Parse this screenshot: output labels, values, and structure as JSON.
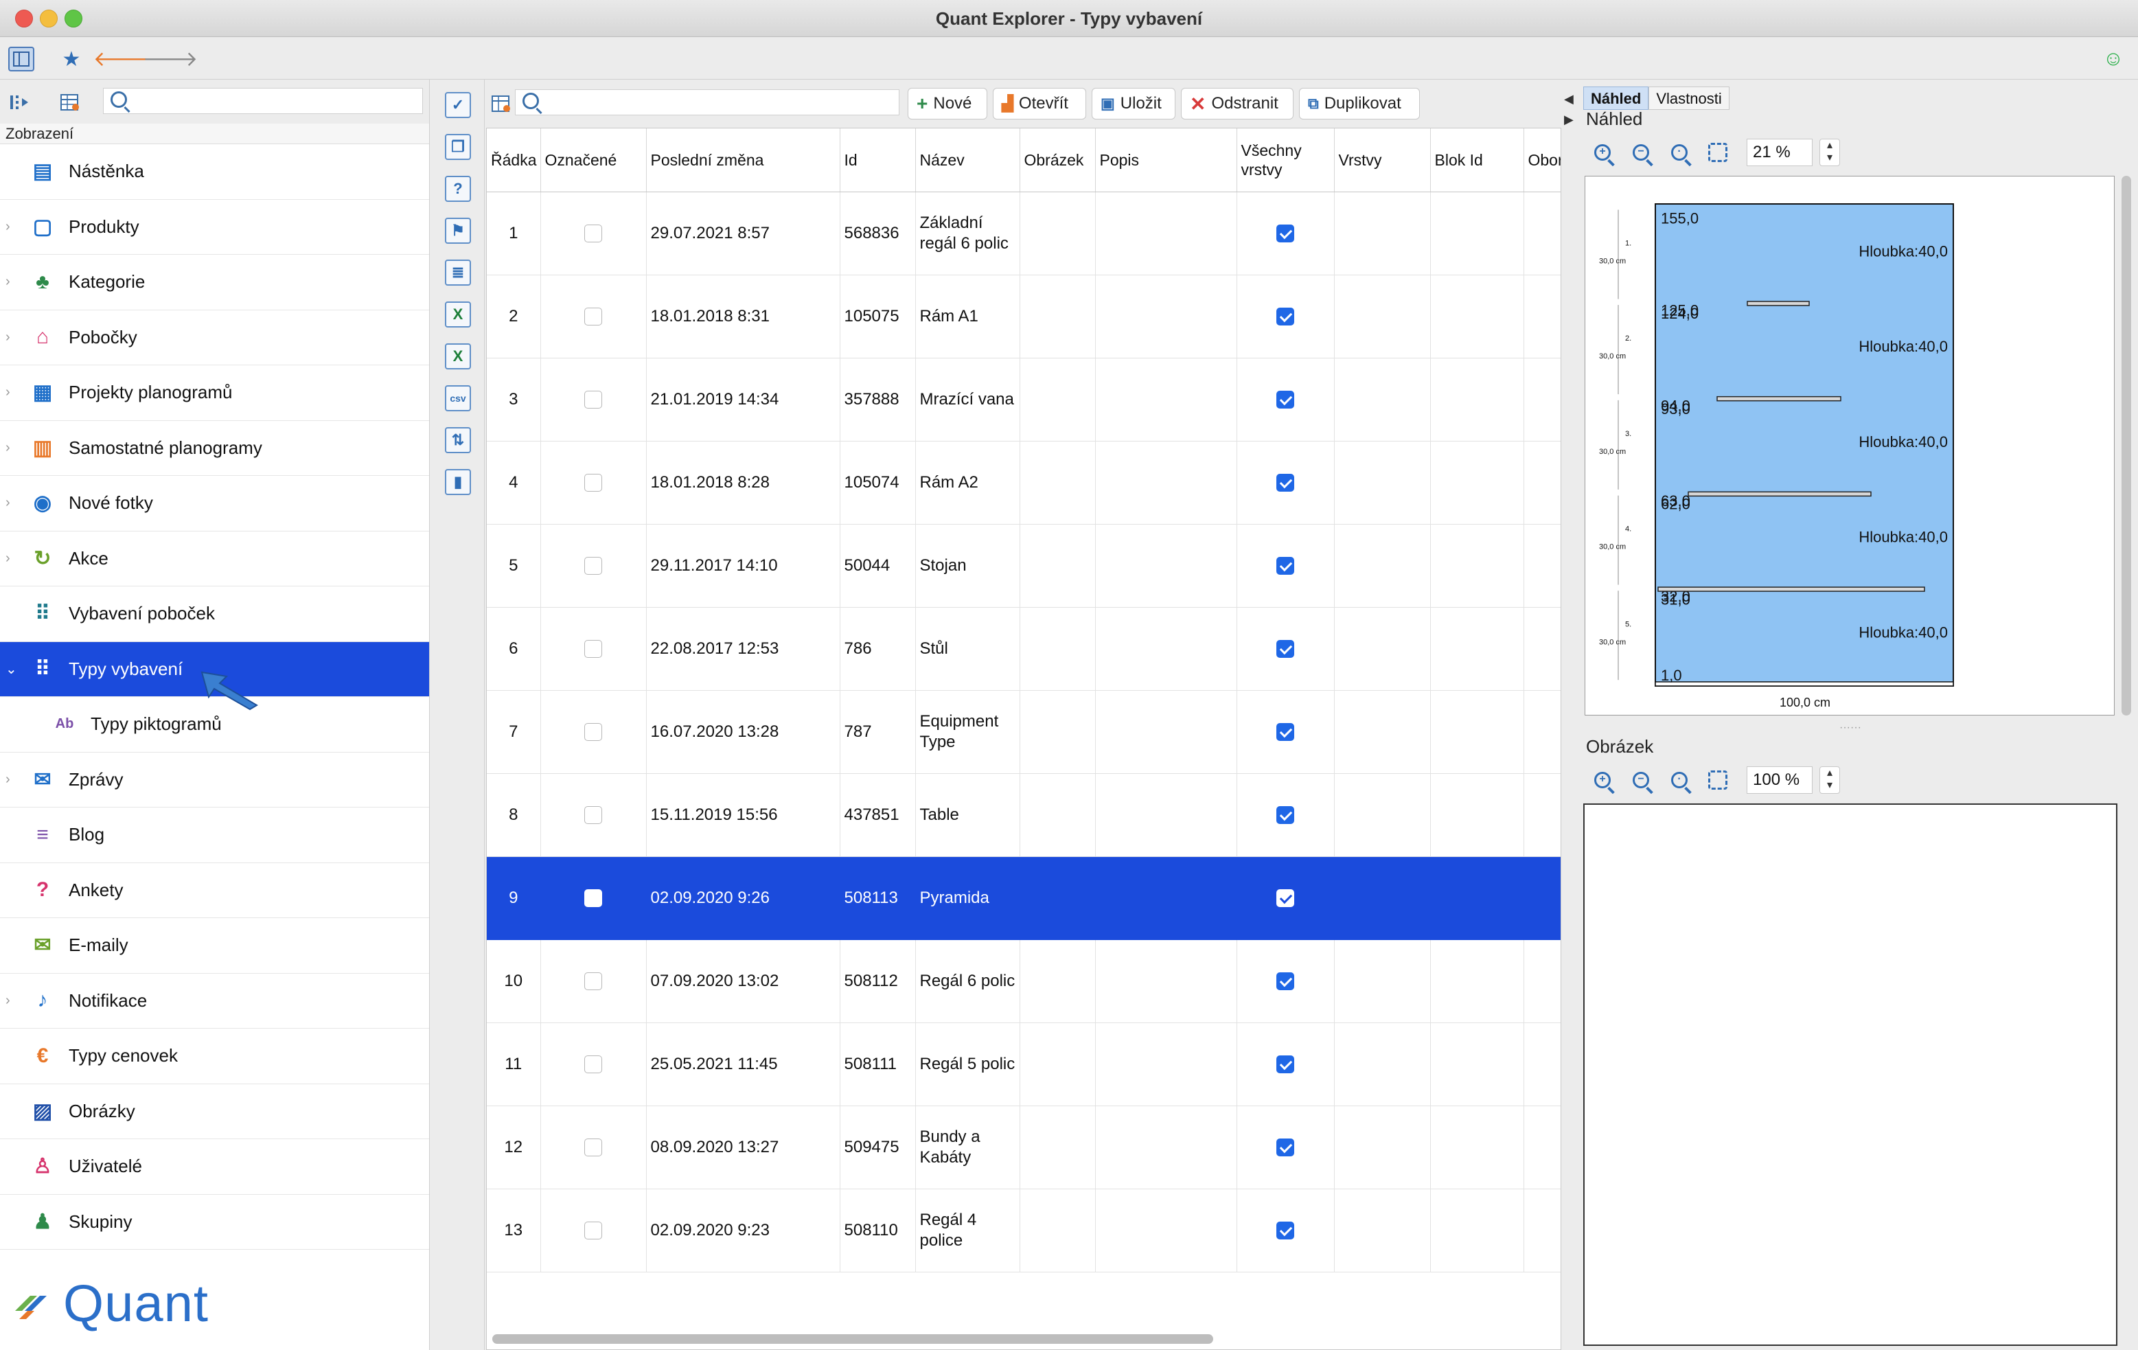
{
  "window": {
    "title": "Quant Explorer - Typy vybavení"
  },
  "toolbar": {
    "sidebar_icon": "sidebar-toggle-icon",
    "favorites_icon": "star-icon",
    "back_icon": "arrow-left-icon",
    "forward_icon": "arrow-right-icon",
    "status_icon": "smiley-icon"
  },
  "left": {
    "search": {
      "value": "",
      "placeholder": ""
    },
    "section_label": "Zobrazení",
    "items": [
      {
        "label": "Nástěnka",
        "icon": "dashboard-icon",
        "expandable": false,
        "color": "#1f6fc9"
      },
      {
        "label": "Produkty",
        "icon": "product-icon",
        "expandable": true,
        "color": "#1f6fc9"
      },
      {
        "label": "Kategorie",
        "icon": "category-tree-icon",
        "expandable": true,
        "color": "#2e8a4a"
      },
      {
        "label": "Pobočky",
        "icon": "store-icon",
        "expandable": true,
        "color": "#d6336c"
      },
      {
        "label": "Projekty planogramů",
        "icon": "planogram-project-icon",
        "expandable": true,
        "color": "#1f6fc9"
      },
      {
        "label": "Samostatné planogramy",
        "icon": "planogram-icon",
        "expandable": true,
        "color": "#e8782a"
      },
      {
        "label": "Nové fotky",
        "icon": "camera-icon",
        "expandable": true,
        "color": "#1f6fc9"
      },
      {
        "label": "Akce",
        "icon": "promo-icon",
        "expandable": true,
        "color": "#6aa02a"
      },
      {
        "label": "Vybavení poboček",
        "icon": "store-equipment-icon",
        "expandable": false,
        "color": "#1f7a8c"
      },
      {
        "label": "Typy vybavení",
        "icon": "equipment-type-icon",
        "expandable": true,
        "expanded": true,
        "selected": true,
        "color": "#1f7a8c"
      },
      {
        "label": "Typy piktogramů",
        "icon": "pictogram-icon",
        "expandable": false,
        "sub": true,
        "color": "#7b4fa8"
      },
      {
        "label": "Zprávy",
        "icon": "message-icon",
        "expandable": true,
        "color": "#1f6fc9"
      },
      {
        "label": "Blog",
        "icon": "blog-icon",
        "expandable": false,
        "color": "#7b4fa8"
      },
      {
        "label": "Ankety",
        "icon": "survey-icon",
        "expandable": false,
        "color": "#d6336c"
      },
      {
        "label": "E-maily",
        "icon": "mail-icon",
        "expandable": false,
        "color": "#6aa02a"
      },
      {
        "label": "Notifikace",
        "icon": "bell-icon",
        "expandable": true,
        "color": "#1f6fc9"
      },
      {
        "label": "Typy cenovek",
        "icon": "price-tag-icon",
        "expandable": false,
        "color": "#e8782a"
      },
      {
        "label": "Obrázky",
        "icon": "image-icon",
        "expandable": false,
        "color": "#1f4fa8"
      },
      {
        "label": "Uživatelé",
        "icon": "user-icon",
        "expandable": false,
        "color": "#d6336c"
      },
      {
        "label": "Skupiny",
        "icon": "group-icon",
        "expandable": false,
        "color": "#2e8a4a"
      }
    ],
    "logo_text": "Quant"
  },
  "middle": {
    "vertical_tools": [
      "select-all-icon",
      "copy-icon",
      "help-table-icon",
      "flag-icon",
      "list-icon",
      "excel-import-icon",
      "excel-export-icon",
      "csv-icon",
      "table-move-icon",
      "chart-icon"
    ],
    "search": {
      "value": "",
      "placeholder": ""
    },
    "buttons": {
      "new": "Nové",
      "open": "Otevřít",
      "save": "Uložit",
      "delete": "Odstranit",
      "duplicate": "Duplikovat"
    },
    "table": {
      "columns": [
        "Řádka",
        "Označené",
        "Poslední změna",
        "Id",
        "Název",
        "Obrázek",
        "Popis",
        "Všechny vrstvy",
        "Vrstvy",
        "Blok Id",
        "Obor"
      ],
      "rows": [
        {
          "row": "1",
          "marked": false,
          "changed": "29.07.2021 8:57",
          "id": "568836",
          "name": "Základní regál 6 polic",
          "image": "",
          "desc": "",
          "all_layers": true,
          "layers": "",
          "block": ""
        },
        {
          "row": "2",
          "marked": false,
          "changed": "18.01.2018 8:31",
          "id": "105075",
          "name": "Rám A1",
          "image": "",
          "desc": "",
          "all_layers": true,
          "layers": "",
          "block": ""
        },
        {
          "row": "3",
          "marked": false,
          "changed": "21.01.2019 14:34",
          "id": "357888",
          "name": "Mrazící vana",
          "image": "",
          "desc": "",
          "all_layers": true,
          "layers": "",
          "block": ""
        },
        {
          "row": "4",
          "marked": false,
          "changed": "18.01.2018 8:28",
          "id": "105074",
          "name": "Rám A2",
          "image": "",
          "desc": "",
          "all_layers": true,
          "layers": "",
          "block": ""
        },
        {
          "row": "5",
          "marked": false,
          "changed": "29.11.2017 14:10",
          "id": "50044",
          "name": "Stojan",
          "image": "",
          "desc": "",
          "all_layers": true,
          "layers": "",
          "block": ""
        },
        {
          "row": "6",
          "marked": false,
          "changed": "22.08.2017 12:53",
          "id": "786",
          "name": "Stůl",
          "image": "",
          "desc": "",
          "all_layers": true,
          "layers": "",
          "block": ""
        },
        {
          "row": "7",
          "marked": false,
          "changed": "16.07.2020 13:28",
          "id": "787",
          "name": "Equipment Type",
          "image": "",
          "desc": "",
          "all_layers": true,
          "layers": "",
          "block": ""
        },
        {
          "row": "8",
          "marked": false,
          "changed": "15.11.2019 15:56",
          "id": "437851",
          "name": "Table",
          "image": "",
          "desc": "",
          "all_layers": true,
          "layers": "",
          "block": ""
        },
        {
          "row": "9",
          "marked": false,
          "changed": "02.09.2020 9:26",
          "id": "508113",
          "name": "Pyramida",
          "image": "",
          "desc": "",
          "all_layers": true,
          "layers": "",
          "block": "",
          "selected": true
        },
        {
          "row": "10",
          "marked": false,
          "changed": "07.09.2020 13:02",
          "id": "508112",
          "name": "Regál 6 polic",
          "image": "",
          "desc": "",
          "all_layers": true,
          "layers": "",
          "block": ""
        },
        {
          "row": "11",
          "marked": false,
          "changed": "25.05.2021 11:45",
          "id": "508111",
          "name": "Regál 5 polic",
          "image": "",
          "desc": "",
          "all_layers": true,
          "layers": "",
          "block": ""
        },
        {
          "row": "12",
          "marked": false,
          "changed": "08.09.2020 13:27",
          "id": "509475",
          "name": "Bundy a Kabáty",
          "image": "",
          "desc": "",
          "all_layers": true,
          "layers": "",
          "block": ""
        },
        {
          "row": "13",
          "marked": false,
          "changed": "02.09.2020 9:23",
          "id": "508110",
          "name": "Regál 4 police",
          "image": "",
          "desc": "",
          "all_layers": true,
          "layers": "",
          "block": ""
        }
      ]
    }
  },
  "right": {
    "tabs": [
      "Náhled",
      "Vlastnosti"
    ],
    "active_tab": "Náhled",
    "preview": {
      "title": "Náhled",
      "zoom": "21 %",
      "fill_color": "#8fc3f3",
      "heights": [
        "155,0",
        "125,0",
        "124,0",
        "94,0",
        "93,0",
        "63,0",
        "62,0",
        "32,0",
        "31,0",
        "1,0"
      ],
      "depth_labels": [
        "Hloubka:40,0",
        "Hloubka:40,0",
        "Hloubka:40,0",
        "Hloubka:40,0",
        "Hloubka:40,0"
      ],
      "section_numbers": [
        "1.",
        "2.",
        "3.",
        "4.",
        "5."
      ],
      "section_dims": [
        "30,0 cm",
        "30,0 cm",
        "30,0 cm",
        "30,0 cm",
        "30,0 cm"
      ],
      "width_label": "100,0 cm"
    },
    "image": {
      "title": "Obrázek",
      "zoom": "100 %"
    }
  }
}
